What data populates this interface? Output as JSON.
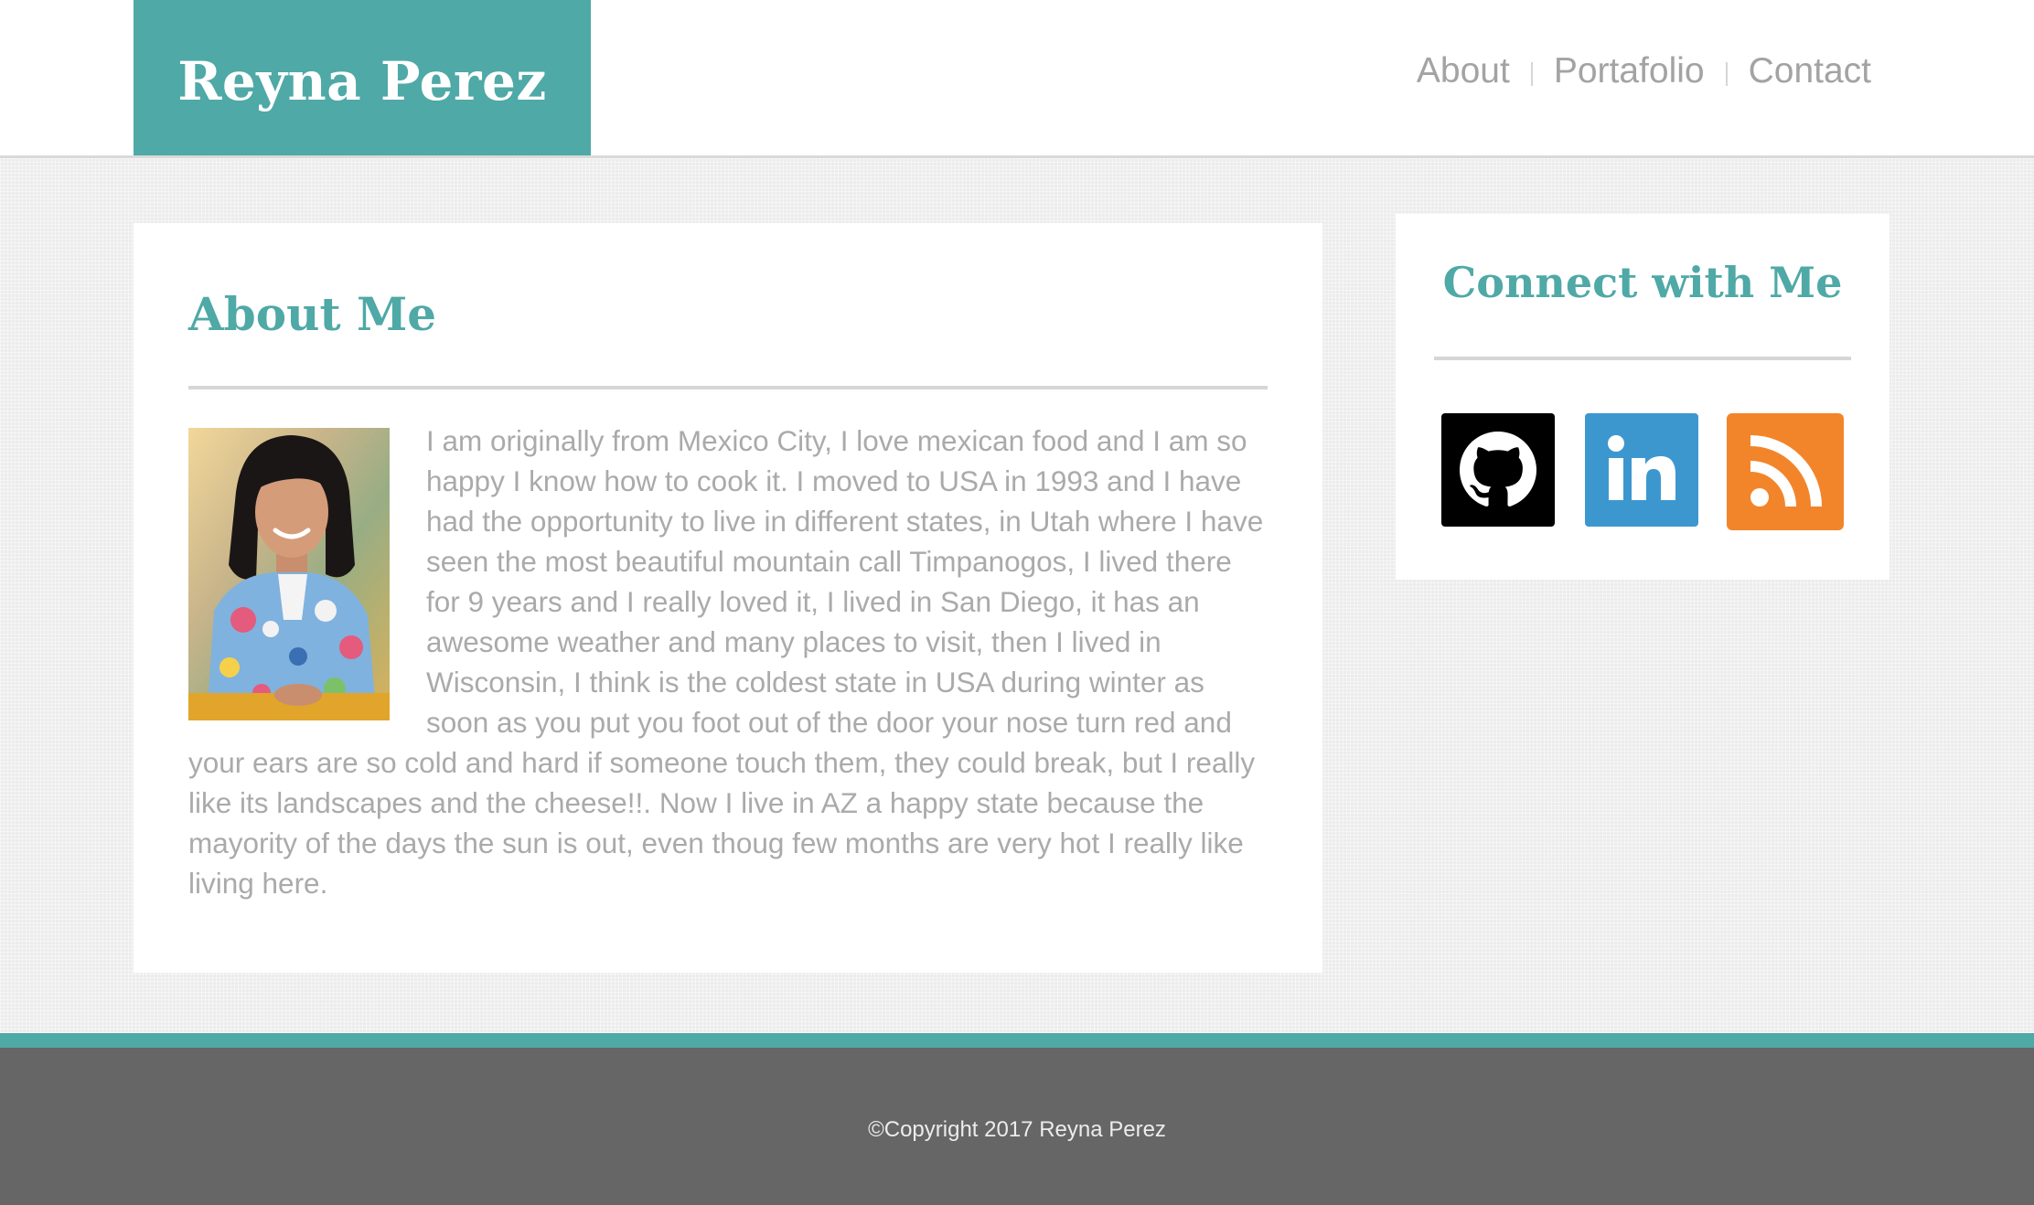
{
  "header": {
    "brand_title": "Reyna Perez",
    "nav": [
      {
        "label": "About"
      },
      {
        "label": "Portafolio"
      },
      {
        "label": "Contact"
      }
    ]
  },
  "about": {
    "title": "About Me",
    "body": "I am originally from Mexico City, I love mexican food and I am so happy I know how to cook it. I moved to USA in 1993 and I have had the opportunity to live in different states, in Utah where I have seen the most beautiful mountain call Timpanogos, I lived there for 9 years and I really loved it, I lived in San Diego, it has an awesome weather and many places to visit, then I lived in Wisconsin, I think is the coldest state in USA during winter as soon as you put you foot out of the door your nose turn red and your ears are so cold and hard if someone touch them, they could break, but I really like its landscapes and the cheese!!. Now I live in AZ a happy state because the mayority of the days the sun is out, even thoug few months are very hot I really like living here."
  },
  "connect": {
    "title": "Connect with Me",
    "icons": [
      {
        "name": "github-icon",
        "color": "#000000"
      },
      {
        "name": "linkedin-icon",
        "color": "#3d97cf"
      },
      {
        "name": "rss-icon",
        "color": "#f2852a"
      }
    ]
  },
  "footer": {
    "copyright": "©Copyright 2017 Reyna Perez"
  },
  "colors": {
    "accent": "#4fa9a6",
    "footer_bg": "#666666",
    "body_text": "#aaaaaa"
  }
}
